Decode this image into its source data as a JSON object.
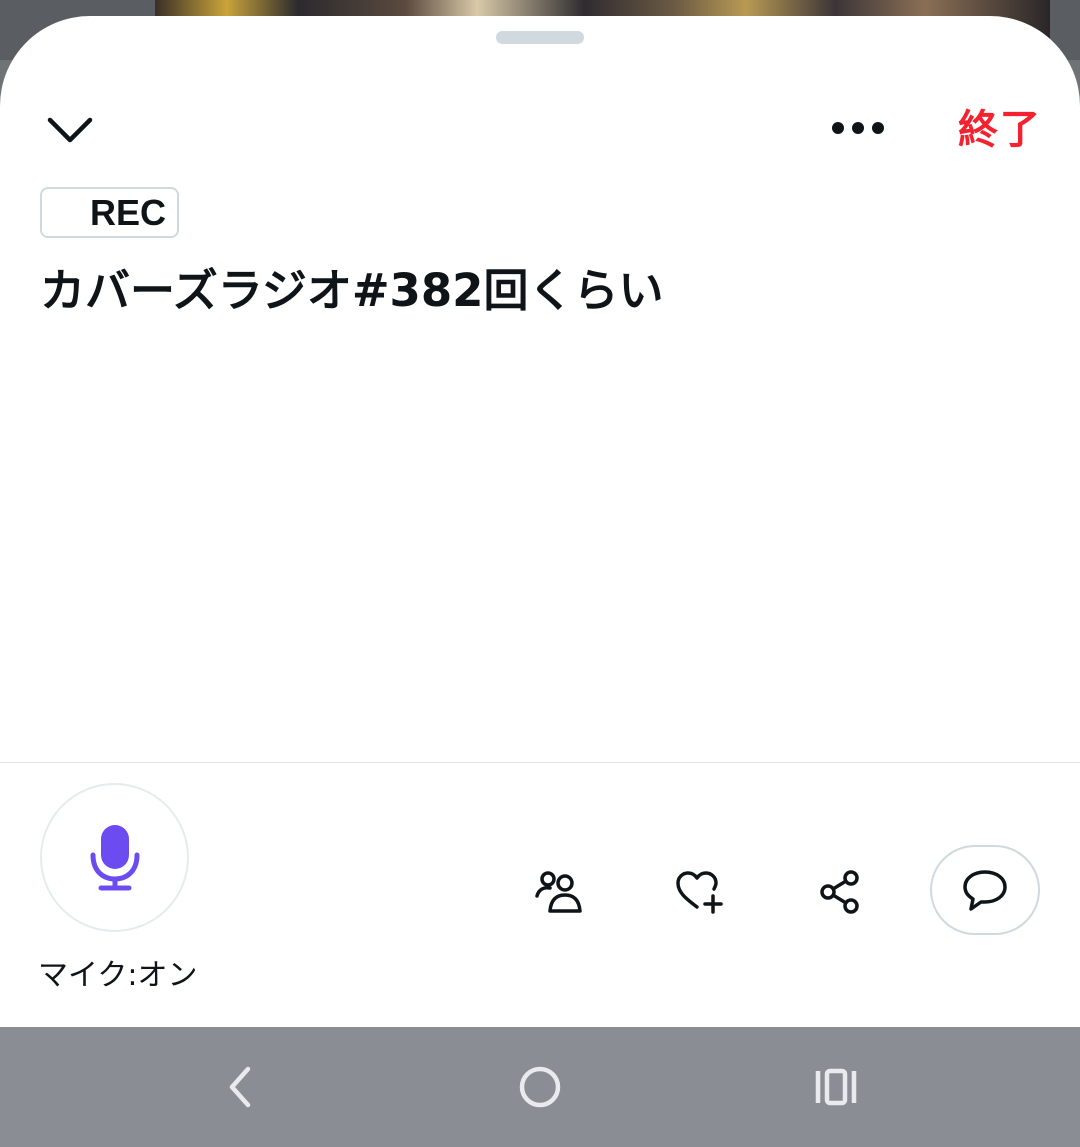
{
  "header": {
    "collapse_icon": "chevron-down-icon",
    "more_icon": "more-horizontal-icon",
    "end_label": "終了"
  },
  "space": {
    "rec_label": "REC",
    "title": "カバーズラジオ#382回くらい"
  },
  "controls": {
    "mic_icon": "microphone-icon",
    "mic_status": "マイク:オン",
    "actions": [
      {
        "icon": "people-icon"
      },
      {
        "icon": "heart-plus-icon"
      },
      {
        "icon": "share-icon"
      },
      {
        "icon": "comment-icon"
      }
    ]
  },
  "navigation": {
    "back_icon": "back-icon",
    "home_icon": "home-icon",
    "recents_icon": "recents-icon"
  },
  "colors": {
    "accent_red": "#f4212e",
    "mic_purple": "#6c4cf1",
    "text_primary": "#0f1419",
    "border": "#cfd9de",
    "nav_bar": "#8a8e94"
  }
}
